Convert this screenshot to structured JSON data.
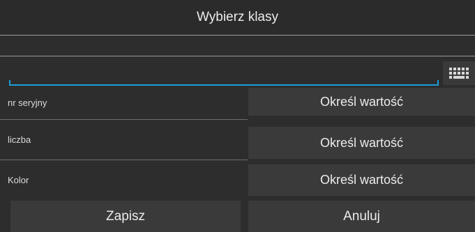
{
  "dialog": {
    "title": "Wybierz klasy"
  },
  "search": {
    "value": "",
    "placeholder": "",
    "keyboard_icon": "keyboard-icon"
  },
  "fields": [
    {
      "label": "nr seryjny",
      "value": "Określ wartość"
    },
    {
      "label": "liczba",
      "value": "Określ wartość"
    },
    {
      "label": "Kolor",
      "value": "Określ wartość"
    }
  ],
  "footer": {
    "save_label": "Zapisz",
    "cancel_label": "Anuluj"
  },
  "colors": {
    "background": "#2d2d2d",
    "accent": "#1a9fd8",
    "button": "#3a3a3a"
  }
}
